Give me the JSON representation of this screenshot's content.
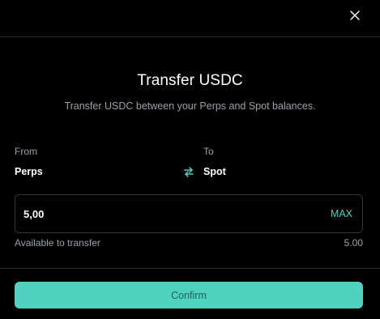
{
  "dialog": {
    "title": "Transfer USDC",
    "subtitle": "Transfer USDC between your Perps and Spot balances."
  },
  "transfer": {
    "from_label": "From",
    "from_value": "Perps",
    "to_label": "To",
    "to_value": "Spot",
    "swap_icon": "swap-arrows-icon"
  },
  "amount": {
    "value": "5,00",
    "max_label": "MAX"
  },
  "availability": {
    "label": "Available to transfer",
    "value": "5.00"
  },
  "footer": {
    "confirm_label": "Confirm"
  },
  "icons": {
    "close": "close-icon"
  },
  "colors": {
    "background": "#000000",
    "accent": "#50d2c1",
    "muted_text": "#9ba0a6",
    "border": "#33363a",
    "confirm_text": "#1f5f58"
  }
}
